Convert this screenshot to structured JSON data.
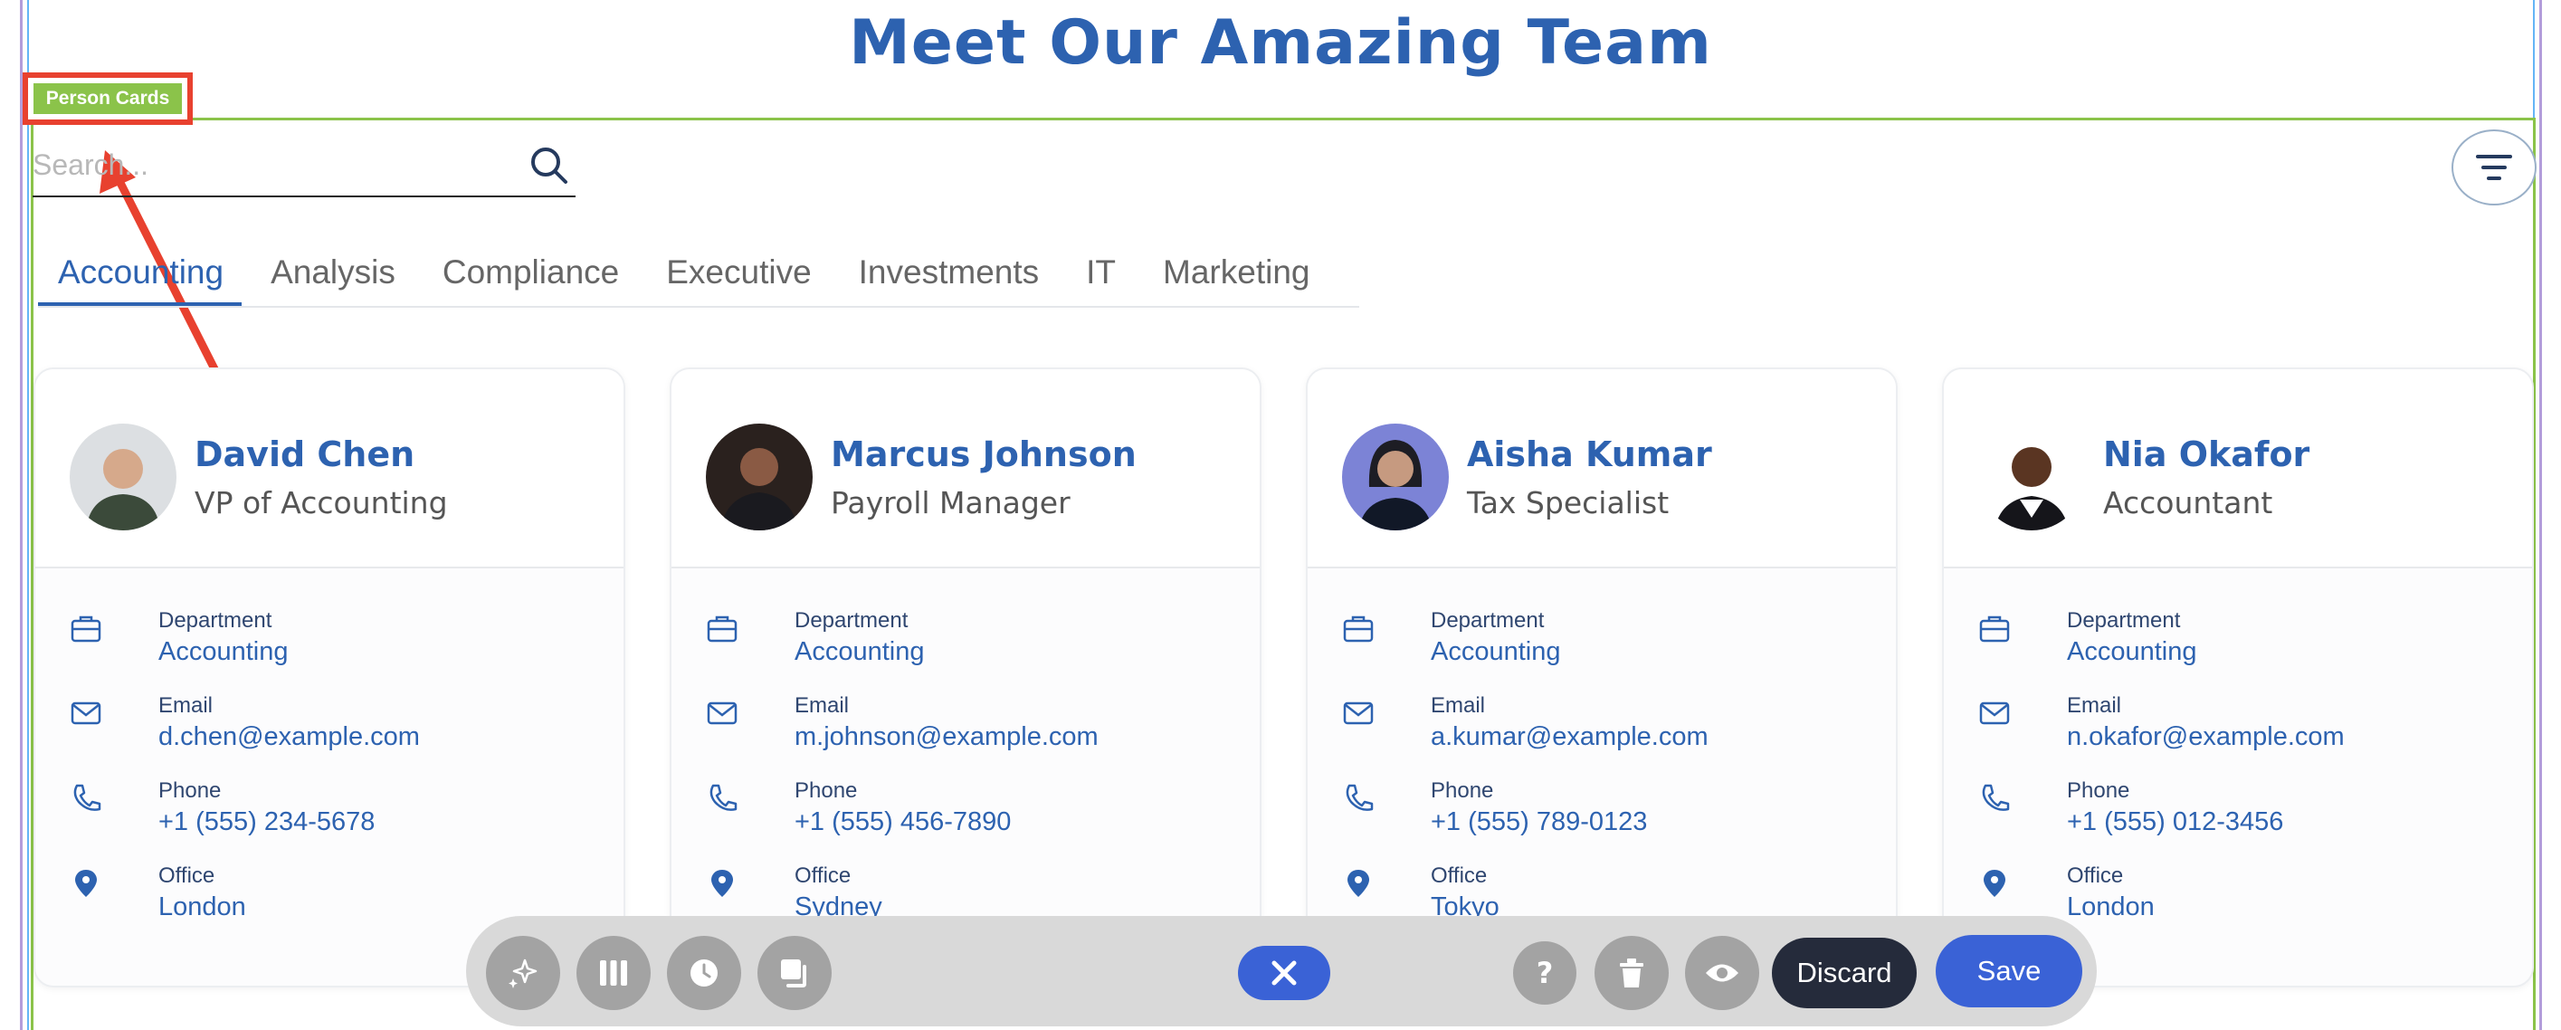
{
  "page": {
    "title_start": "Meet Our ",
    "title_highlight": "Amazing",
    "title_end": " Team",
    "section_tag": "Person Cards"
  },
  "search": {
    "placeholder": "Search..."
  },
  "tabs": [
    "Accounting",
    "Analysis",
    "Compliance",
    "Executive",
    "Investments",
    "IT",
    "Marketing"
  ],
  "active_tab": "Accounting",
  "colors": {
    "accent": "#2d62b0",
    "section_border": "#8bc34a",
    "annotation": "#e8412f",
    "primary_button": "#3a62d6",
    "dark_button": "#252b3b"
  },
  "field_labels": {
    "department": "Department",
    "email": "Email",
    "phone": "Phone",
    "office": "Office"
  },
  "cards": [
    {
      "name": "David Chen",
      "role": "VP of Accounting",
      "department": "Accounting",
      "email": "d.chen@example.com",
      "phone": "+1 (555) 234-5678",
      "office": "London"
    },
    {
      "name": "Marcus Johnson",
      "role": "Payroll Manager",
      "department": "Accounting",
      "email": "m.johnson@example.com",
      "phone": "+1 (555) 456-7890",
      "office": "Sydney"
    },
    {
      "name": "Aisha Kumar",
      "role": "Tax Specialist",
      "department": "Accounting",
      "email": "a.kumar@example.com",
      "phone": "+1 (555) 789-0123",
      "office": "Tokyo"
    },
    {
      "name": "Nia Okafor",
      "role": "Accountant",
      "department": "Accounting",
      "email": "n.okafor@example.com",
      "phone": "+1 (555) 012-3456",
      "office": "London"
    }
  ],
  "toolbar": {
    "discard_label": "Discard",
    "save_label": "Save",
    "icons": [
      "sparkle-icon",
      "columns-icon",
      "clock-icon",
      "copy-icon",
      "close-icon",
      "help-icon",
      "trash-icon",
      "eye-icon"
    ]
  }
}
